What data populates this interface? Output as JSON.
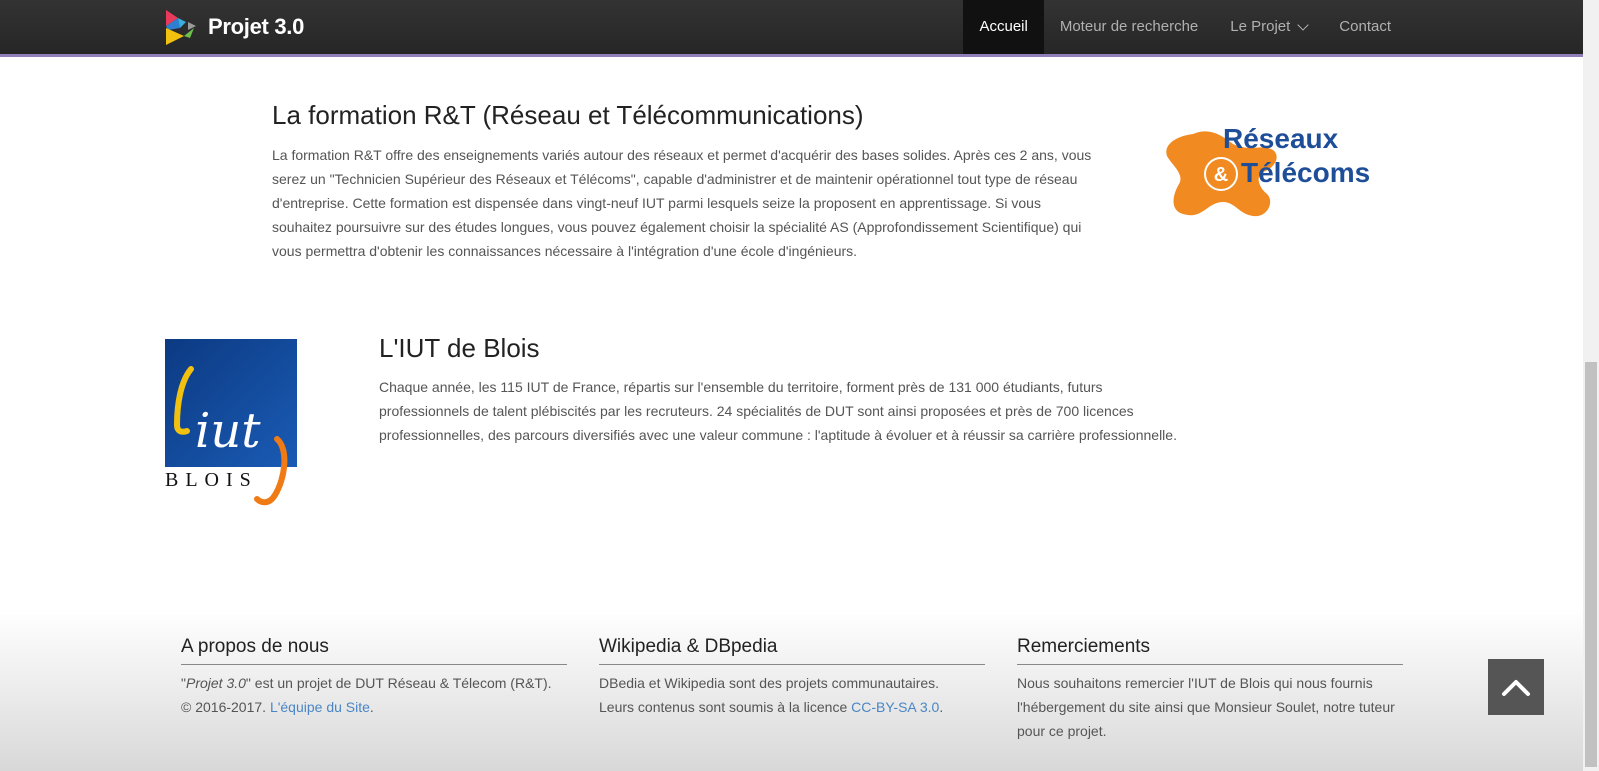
{
  "navbar": {
    "brand": "Projet 3.0",
    "items": [
      {
        "label": "Accueil",
        "active": true
      },
      {
        "label": "Moteur de recherche",
        "active": false
      },
      {
        "label": "Le Projet",
        "active": false,
        "dropdown": true
      },
      {
        "label": "Contact",
        "active": false
      }
    ],
    "accent_color": "#8e7fb8"
  },
  "rt_section": {
    "title": "La formation R&T (Réseau et Télécommunications)",
    "text": "La formation R&T offre des enseignements variés autour des réseaux et permet d'acquérir des bases solides. Après ces 2 ans, vous serez un \"Technicien Supérieur des Réseaux et Télécoms\", capable d'administrer et de maintenir opérationnel tout type de réseau d'entreprise. Cette formation est dispensée dans vingt-neuf IUT parmi lesquels seize la proposent en apprentissage. Si vous souhaitez poursuivre sur des études longues, vous pouvez également choisir la spécialité AS (Approfondissement Scientifique) qui vous permettra d'obtenir les connaissances nécessaire à l'intégration d'une école d'ingénieurs.",
    "logo": {
      "line1": "Réseaux",
      "amp": "&",
      "line2": "Télécoms"
    }
  },
  "iut_section": {
    "title": "L'IUT de Blois",
    "text": "Chaque année, les 115 IUT de France, répartis sur l'ensemble du territoire, forment près de 131 000 étudiants, futurs professionnels de talent plébiscités par les recruteurs. 24 spécialités de DUT sont ainsi proposées et près de 700 licences professionnelles, des parcours diversifiés avec une valeur commune : l'aptitude à évoluer et à réussir sa carrière professionnelle.",
    "logo": {
      "word": "iut",
      "city": "BLOIS"
    }
  },
  "footer": {
    "about": {
      "title": "A propos de nous",
      "project_name": "Projet 3.0",
      "line1_rest": " est un projet de DUT Réseau & Télecom (R&T).",
      "copyright": "© 2016-2017. ",
      "team_link": "L'équipe du Site",
      "period": "."
    },
    "wiki": {
      "title": "Wikipedia & DBpedia",
      "line1": "DBedia et Wikipedia sont des projets communautaires.",
      "line2": "Leurs contenus sont soumis à la licence ",
      "license_link": "CC-BY-SA 3.0",
      "period": "."
    },
    "thanks": {
      "title": "Remerciements",
      "text": "Nous souhaitons remercier l'IUT de Blois qui nous fournis l'hébergement du site ainsi que Monsieur Soulet, notre tuteur pour ce projet."
    }
  },
  "back_to_top_icon": "chevron-up-icon"
}
